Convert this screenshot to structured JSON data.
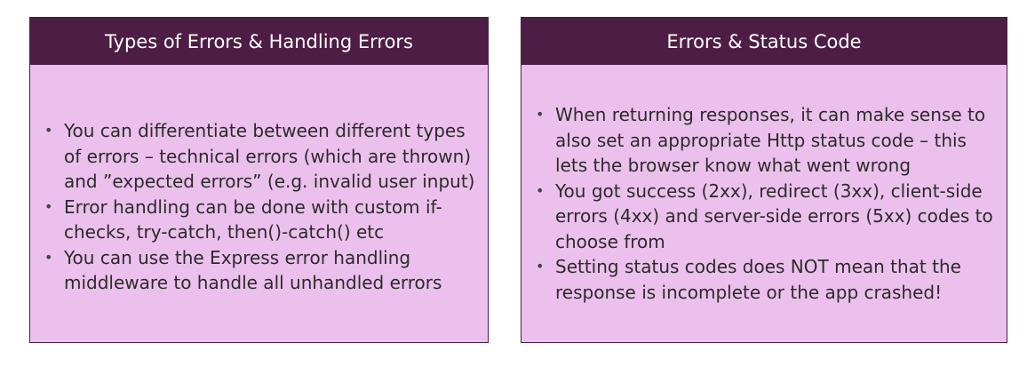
{
  "left_card": {
    "title": "Types of Errors & Handling Errors",
    "bullets": [
      "You can differentiate between different types of errors – technical errors (which are thrown) and ”expected errors” (e.g. invalid user input)",
      "Error handling can be done with custom if-checks, try-catch, then()-catch() etc",
      "You can use the Express error handling middleware to handle all unhandled errors"
    ]
  },
  "right_card": {
    "title": "Errors & Status Code",
    "bullets": [
      "When returning responses, it can make sense to also set an appropriate Http status code – this lets the browser know what went wrong",
      "You got success (2xx), redirect (3xx), client-side errors (4xx) and server-side errors (5xx) codes to choose from",
      "Setting status codes does NOT mean that the response is incomplete or the app crashed!"
    ]
  },
  "bullet_symbol": "•",
  "colors": {
    "header_bg": "#4e1d45",
    "body_bg": "#ecc0ec",
    "border": "#4a2040"
  }
}
